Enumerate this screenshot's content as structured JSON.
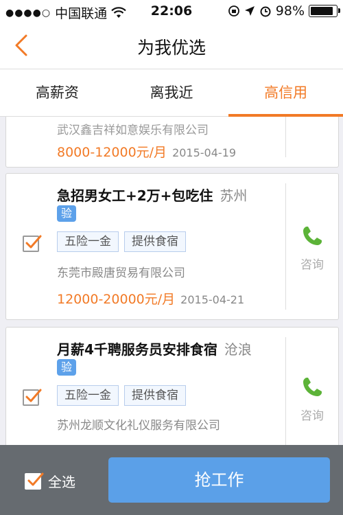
{
  "status_bar": {
    "carrier": "中国联通",
    "time": "22:06",
    "battery": "98%",
    "battery_level": 0.98
  },
  "nav": {
    "title": "为我优选"
  },
  "tabs": [
    {
      "label": "高薪资"
    },
    {
      "label": "离我近"
    },
    {
      "label": "高信用"
    }
  ],
  "jobs": [
    {
      "title": "",
      "city": "",
      "company": "武汉鑫吉祥如意娱乐有限公司",
      "salary": "8000-12000元/月",
      "date": "2015-04-19"
    },
    {
      "title": "急招男女工+2万+包吃住",
      "city": "苏州",
      "verify": "验",
      "tags": [
        "五险一金",
        "提供食宿"
      ],
      "company": "东莞市殿唐贸易有限公司",
      "salary": "12000-20000元/月",
      "date": "2015-04-21",
      "consult": "咨询",
      "checked": true
    },
    {
      "title": "月薪4千聘服务员安排食宿",
      "city": "沧浪",
      "verify": "验",
      "tags": [
        "五险一金",
        "提供食宿"
      ],
      "company": "苏州龙顺文化礼仪服务有限公司",
      "consult": "咨询",
      "checked": true
    }
  ],
  "bottom": {
    "select_all": "全选",
    "grab_button": "抢工作"
  },
  "colors": {
    "accent": "#f27a26",
    "button_blue": "#5ba0e8",
    "phone_green": "#5cb338"
  }
}
